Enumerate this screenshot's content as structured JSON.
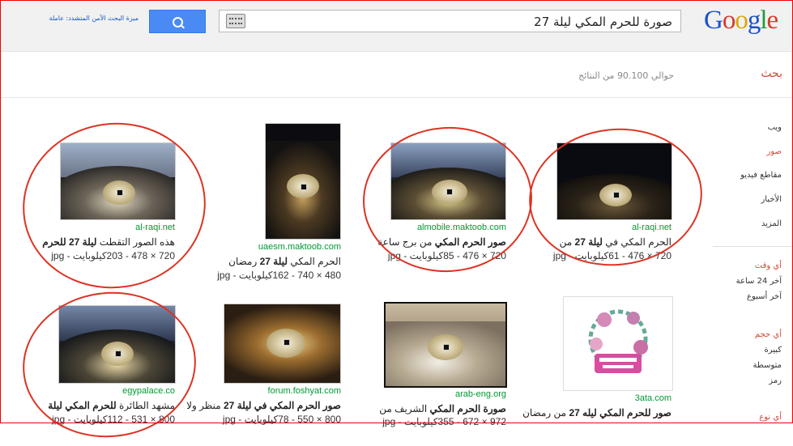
{
  "header": {
    "logo_letters": [
      "G",
      "o",
      "o",
      "g",
      "l",
      "e"
    ],
    "query": "صورة للحرم المكي ليلة 27",
    "safe_search": "ميزة البحث الآمن المتشدد: عاملة"
  },
  "subheader": {
    "search_label": "بحث",
    "result_count": "حوالي 90.100 من النتائج"
  },
  "sidebar": {
    "types": [
      "ويب",
      "صور",
      "مقاطع فيديو",
      "الأخبار",
      "المزيد"
    ],
    "active_type": "صور",
    "time_heading": "أي وقت",
    "time_options": [
      "آخر 24 ساعة",
      "آخر أسبوع"
    ],
    "size_heading": "أي حجم",
    "size_options": [
      "كبيرة",
      "متوسطة",
      "رمز"
    ],
    "type_heading": "أي نوع"
  },
  "results": [
    {
      "url": "al-raqi.net",
      "title_plain": "الحرم المكي في ",
      "title_bold": "ليلة 27",
      "title_after": " من",
      "meta": "720 × 476 - 61كيلوبايت - jpg"
    },
    {
      "url": "almobile.maktoob.com",
      "title_plain": "صور الحرم المكي",
      "title_bold": "",
      "title_after": " من برج ساعة",
      "meta": "720 × 476 - 85كيلوبايت - jpg"
    },
    {
      "url": "uaesm.maktoob.com",
      "title_plain": "الحرم المكي ",
      "title_bold": "ليلة 27",
      "title_after": " رمضان",
      "meta": "480 × 740 - 162كيلوبايت - jpg"
    },
    {
      "url": "al-raqi.net",
      "title_plain": "هذه الصور التقطت ",
      "title_bold": "ليلة 27",
      "title_after": " للحرم",
      "meta": "720 × 478 - 203كيلوبايت - jpg"
    },
    {
      "url": "3ata.com",
      "title_plain": "صور للحرم المكي ",
      "title_bold": "ليله 27",
      "title_after": " من رمضان",
      "meta": ""
    },
    {
      "url": "arab-eng.org",
      "title_plain": "صورة الحرم المكي",
      "title_bold": "",
      "title_after": " الشريف من",
      "meta": "972 × 672 - 355كيلوبايت - jpg"
    },
    {
      "url": "forum.foshyat.com",
      "title_plain": "صور الحرم المكي في ",
      "title_bold": "ليلة 27",
      "title_after": " منظر ولا",
      "meta": "800 × 550 - 78كيلوبايت - jpg"
    },
    {
      "url": "egypalace.co",
      "title_plain": "مشهد الطائرة ",
      "title_bold": "للحرم المكي ليلة",
      "title_after": "",
      "meta": "800 × 531 - 112كيلوبايت - jpg"
    }
  ]
}
